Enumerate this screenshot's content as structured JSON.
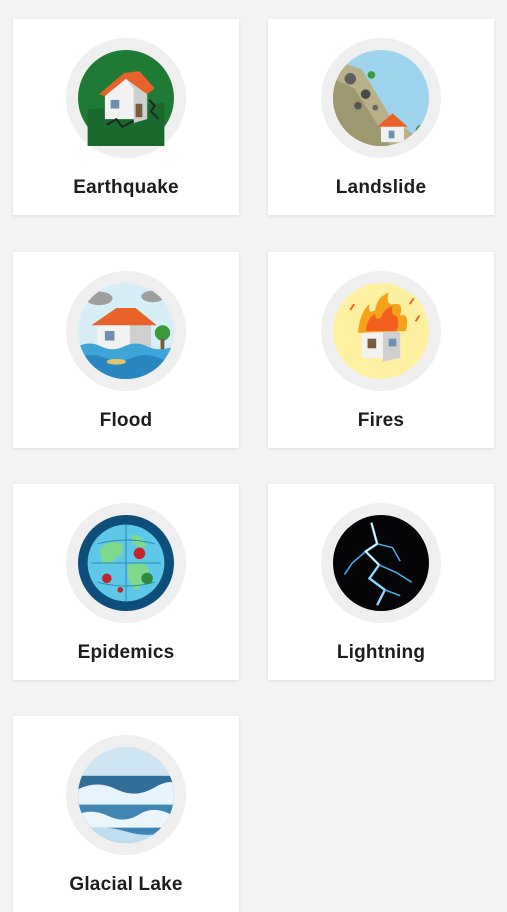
{
  "categories": [
    {
      "label": "Earthquake",
      "icon": "earthquake-icon"
    },
    {
      "label": "Landslide",
      "icon": "landslide-icon"
    },
    {
      "label": "Flood",
      "icon": "flood-icon"
    },
    {
      "label": "Fires",
      "icon": "fire-icon"
    },
    {
      "label": "Epidemics",
      "icon": "epidemics-icon"
    },
    {
      "label": "Lightning",
      "icon": "lightning-icon"
    },
    {
      "label": "Glacial Lake",
      "icon": "glacial-lake-icon"
    }
  ]
}
